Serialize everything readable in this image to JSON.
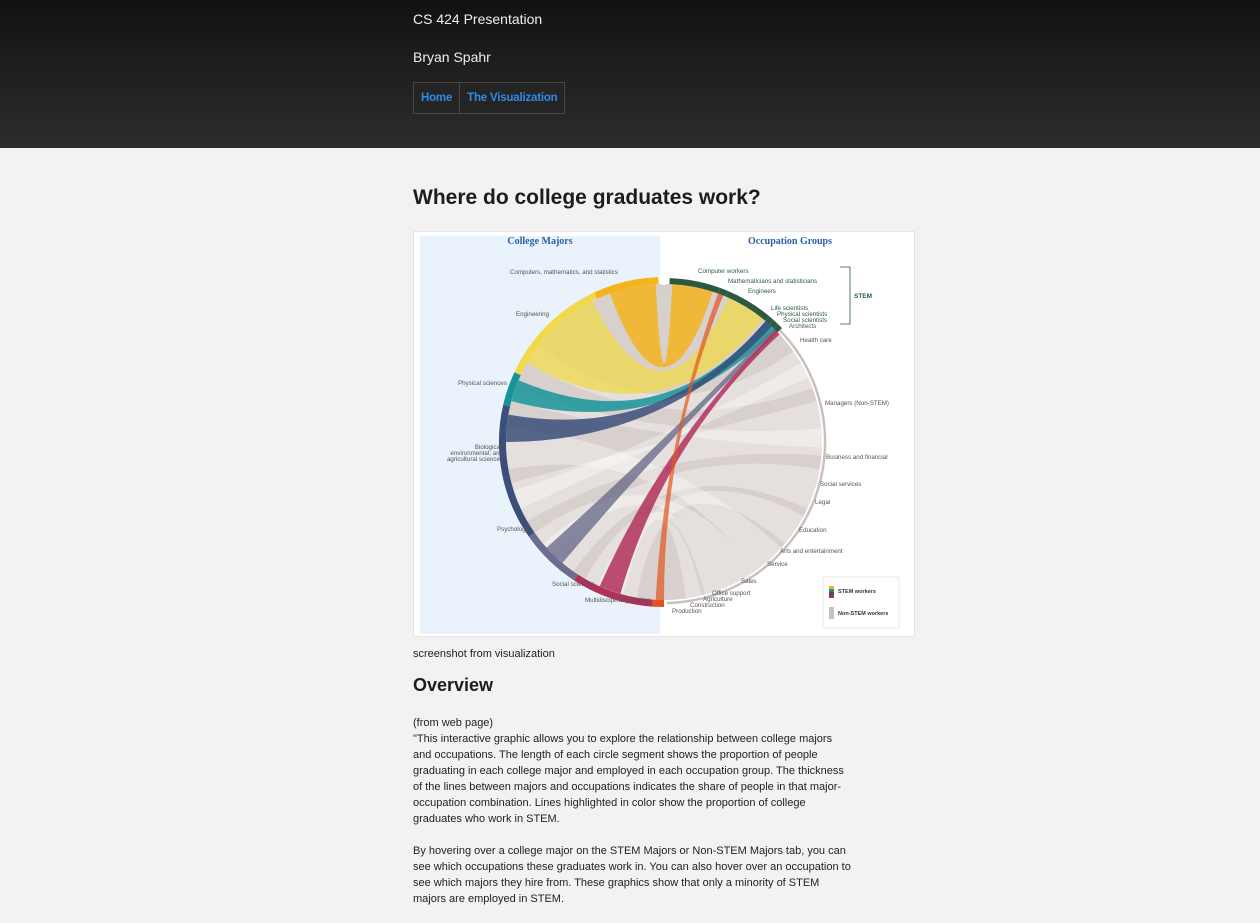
{
  "header": {
    "site_title": "CS 424 Presentation",
    "author": "Bryan Spahr",
    "nav": [
      {
        "label": "Home"
      },
      {
        "label": "The Visualization"
      }
    ]
  },
  "main": {
    "page_title": "Where do college graduates work?",
    "caption": "screenshot from visualization",
    "overview_heading": "Overview",
    "source_note": "(from web page)",
    "paragraph_1": "\"This interactive graphic allows you to explore the relationship between college majors and occupations. The length of each circle segment shows the proportion of people graduating in each college major and employed in each occupation group. The thickness of the lines between majors and occupations indicates the share of people in that major-occupation combination. Lines highlighted in color show the proportion of college graduates who work in STEM.",
    "paragraph_2": "By hovering over a college major on the STEM Majors or Non-STEM Majors tab, you can see which occupations these graduates work in. You can also hover over an occupation to see which majors they hire from. These graphics show that only a minority of STEM majors are employed in STEM."
  },
  "figure": {
    "left_heading": "College Majors",
    "right_heading": "Occupation Groups",
    "stem_label": "STEM",
    "majors": [
      {
        "label": "Computers, mathematics, and statistics",
        "color": "#f5b31d"
      },
      {
        "label": "Engineering",
        "color": "#f0d94a"
      },
      {
        "label": "Physical sciences",
        "color": "#16949a"
      },
      {
        "label": "Biological, environmental, and agricultural sciences",
        "color": "#3b4f7a"
      },
      {
        "label": "Psychology",
        "color": "#6b6e8c"
      },
      {
        "label": "Social sciences",
        "color": "#b0305a"
      },
      {
        "label": "Multidisciplinary studies",
        "color": "#e2541e"
      }
    ],
    "major_label_lines": {
      "bio_1": "Biological,",
      "bio_2": "environmental, and",
      "bio_3": "agricultural  sciences"
    },
    "occupations": [
      {
        "label": "Computer workers",
        "stem": true
      },
      {
        "label": "Mathematicians and statisticians",
        "stem": true
      },
      {
        "label": "Engineers",
        "stem": true
      },
      {
        "label": "Life scientists",
        "stem": true
      },
      {
        "label": "Physical scientists",
        "stem": true
      },
      {
        "label": "Social scientists",
        "stem": true
      },
      {
        "label": "Architects",
        "stem": false
      },
      {
        "label": "Health care",
        "stem": false
      },
      {
        "label": "Managers (Non-STEM)",
        "stem": false
      },
      {
        "label": "Business and financial",
        "stem": false
      },
      {
        "label": "Social services",
        "stem": false
      },
      {
        "label": "Legal",
        "stem": false
      },
      {
        "label": "Education",
        "stem": false
      },
      {
        "label": "Arts and entertainment",
        "stem": false
      },
      {
        "label": "Service",
        "stem": false
      },
      {
        "label": "Sales",
        "stem": false
      },
      {
        "label": "Office support",
        "stem": false
      },
      {
        "label": "Agriculture",
        "stem": false
      },
      {
        "label": "Construction",
        "stem": false
      },
      {
        "label": "Production",
        "stem": false
      }
    ],
    "legend": {
      "stem": "STEM workers",
      "non_stem": "Non-STEM workers"
    },
    "colors": {
      "stem_green": "#2d5a3f",
      "non_stem_gray": "#c9c0bd",
      "panel_blue": "#eaf3fb",
      "heading_blue": "#2b5fa8"
    }
  }
}
